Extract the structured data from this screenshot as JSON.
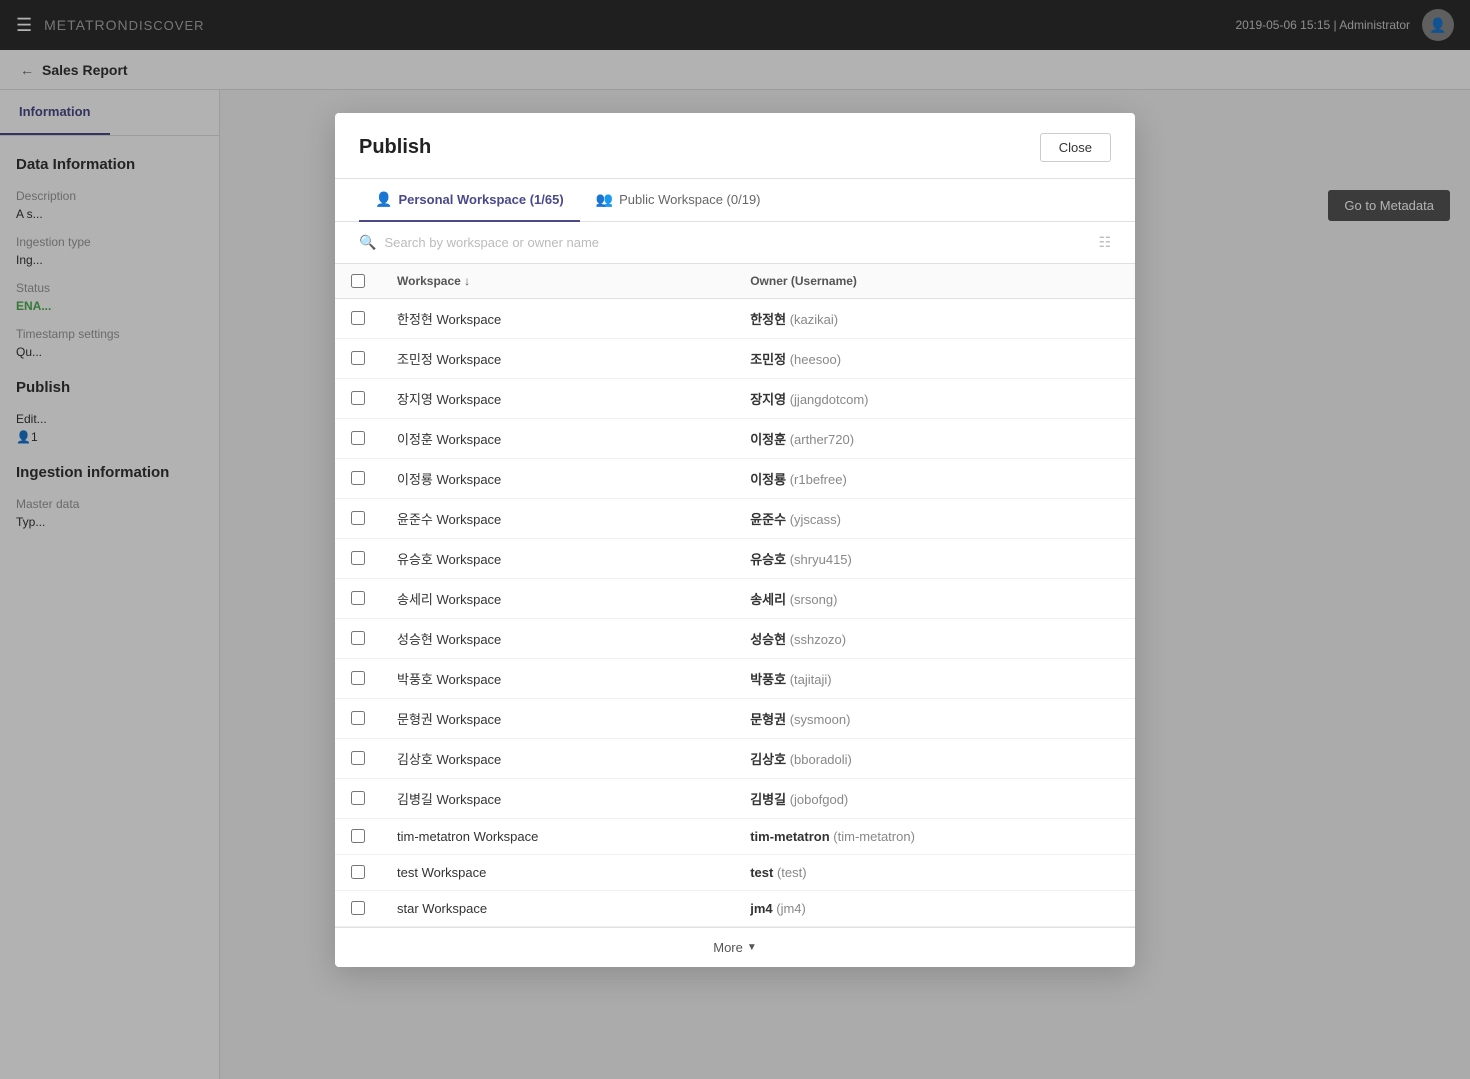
{
  "app": {
    "brand": "METATRON",
    "brand_suffix": "DISCOVER",
    "page_title": "Sales Report",
    "nav_date": "2019-05-06 15:15 | Administrator",
    "go_metadata_label": "Go to Metadata"
  },
  "sidebar": {
    "tabs": [
      {
        "id": "information",
        "label": "Information",
        "active": true
      },
      {
        "id": "tab2",
        "label": "",
        "active": false
      }
    ],
    "sections": [
      {
        "title": "Data Information",
        "fields": [
          {
            "label": "Description",
            "value": "A s..."
          },
          {
            "label": "Ingestion type",
            "value": "Ing..."
          },
          {
            "label": "Status",
            "value": "ENA...",
            "type": "enabled"
          },
          {
            "label": "Timestamp settings",
            "value": "Qu..."
          }
        ]
      },
      {
        "title": "Publish",
        "fields": [
          {
            "label": "",
            "value": "Edit..."
          },
          {
            "label": "",
            "value": "1"
          }
        ]
      },
      {
        "title": "Ingestion information",
        "fields": [
          {
            "label": "Master data",
            "value": "Typ..."
          }
        ]
      }
    ]
  },
  "modal": {
    "title": "Publish",
    "close_label": "Close",
    "tabs": [
      {
        "id": "personal",
        "icon": "person",
        "label": "Personal Workspace",
        "count": "1/65",
        "active": true
      },
      {
        "id": "public",
        "icon": "group",
        "label": "Public Workspace",
        "count": "0/19",
        "active": false
      }
    ],
    "search_placeholder": "Search by workspace or owner name",
    "table": {
      "columns": [
        {
          "key": "workspace",
          "label": "Workspace",
          "sortable": true
        },
        {
          "key": "owner",
          "label": "Owner (Username)"
        }
      ],
      "rows": [
        {
          "workspace": "한정현 Workspace",
          "owner_name": "한정현",
          "owner_username": "kazikai"
        },
        {
          "workspace": "조민정 Workspace",
          "owner_name": "조민정",
          "owner_username": "heesoo"
        },
        {
          "workspace": "장지영 Workspace",
          "owner_name": "장지영",
          "owner_username": "jjangdotcom"
        },
        {
          "workspace": "이정훈 Workspace",
          "owner_name": "이정훈",
          "owner_username": "arther720"
        },
        {
          "workspace": "이정룡 Workspace",
          "owner_name": "이정룡",
          "owner_username": "r1befree"
        },
        {
          "workspace": "윤준수 Workspace",
          "owner_name": "윤준수",
          "owner_username": "yjscass"
        },
        {
          "workspace": "유승호 Workspace",
          "owner_name": "유승호",
          "owner_username": "shryu415"
        },
        {
          "workspace": "송세리 Workspace",
          "owner_name": "송세리",
          "owner_username": "srsong"
        },
        {
          "workspace": "성승현 Workspace",
          "owner_name": "성승현",
          "owner_username": "sshzozo"
        },
        {
          "workspace": "박풍호 Workspace",
          "owner_name": "박풍호",
          "owner_username": "tajitaji"
        },
        {
          "workspace": "문형권 Workspace",
          "owner_name": "문형권",
          "owner_username": "sysmoon"
        },
        {
          "workspace": "김상호 Workspace",
          "owner_name": "김상호",
          "owner_username": "bboradoli"
        },
        {
          "workspace": "김병길 Workspace",
          "owner_name": "김병길",
          "owner_username": "jobofgod"
        },
        {
          "workspace": "tim-metatron Workspace",
          "owner_name": "tim-metatron",
          "owner_username": "tim-metatron"
        },
        {
          "workspace": "test Workspace",
          "owner_name": "test",
          "owner_username": "test"
        },
        {
          "workspace": "star Workspace",
          "owner_name": "jm4",
          "owner_username": "jm4"
        }
      ]
    },
    "more_label": "More"
  }
}
